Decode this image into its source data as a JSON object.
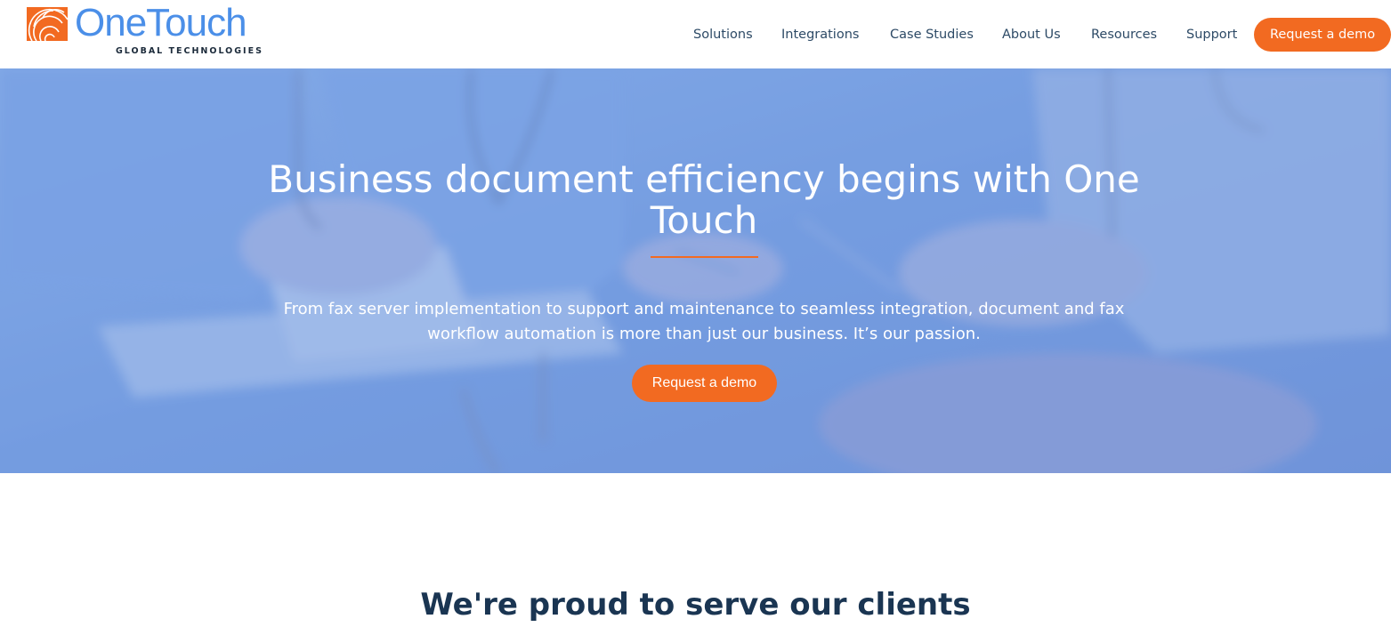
{
  "brand": {
    "name": "OneTouch",
    "tagline": "GLOBAL TECHNOLOGIES",
    "logo_icon": "fingerprint-logo-icon",
    "color_primary": "#4b8fe8",
    "color_accent": "#f26a21"
  },
  "nav": {
    "items": [
      {
        "label": "Solutions"
      },
      {
        "label": "Integrations"
      },
      {
        "label": "Case Studies"
      },
      {
        "label": "About Us"
      },
      {
        "label": "Resources"
      },
      {
        "label": "Support"
      }
    ],
    "cta_label": "Request a demo"
  },
  "hero": {
    "title": "Business document efficiency begins with One Touch",
    "subtitle": "From fax server implementation to support and maintenance to seamless integration, document and fax workflow automation is more than just our business. It’s our passion.",
    "cta_label": "Request a demo",
    "background": "medical-team-photo"
  },
  "clients": {
    "title": "We're proud to serve our clients"
  }
}
